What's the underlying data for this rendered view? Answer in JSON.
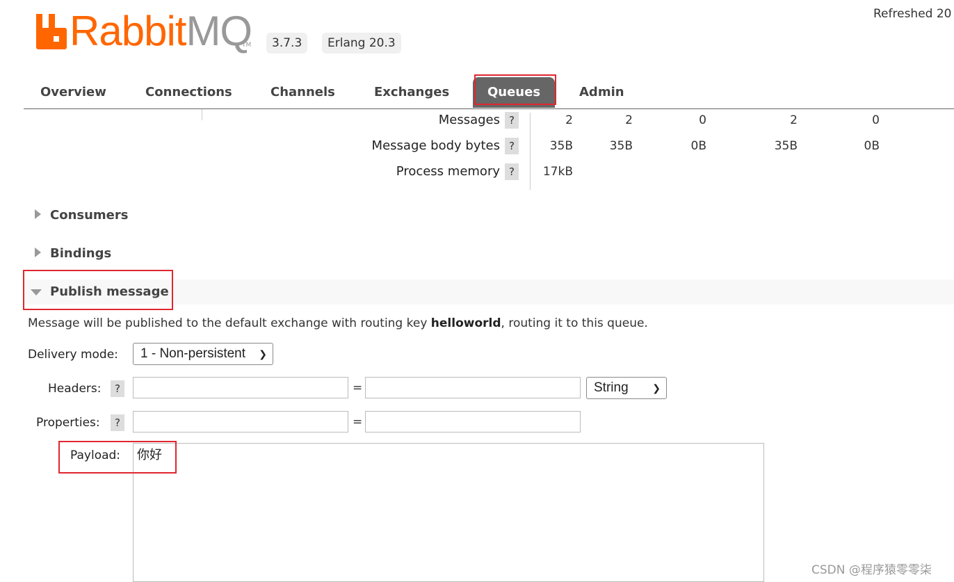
{
  "header": {
    "logo_text_a": "Rabbit",
    "logo_text_b": "MQ",
    "logo_tm": "TM",
    "version": "3.7.3",
    "erlang": "Erlang 20.3",
    "refreshed": "Refreshed 20"
  },
  "tabs": [
    "Overview",
    "Connections",
    "Channels",
    "Exchanges",
    "Queues",
    "Admin"
  ],
  "active_tab": "Queues",
  "stats": {
    "rows": [
      {
        "label": "Messages",
        "values": [
          "2",
          "2",
          "0",
          "2",
          "0"
        ]
      },
      {
        "label": "Message body bytes",
        "values": [
          "35B",
          "35B",
          "0B",
          "35B",
          "0B"
        ]
      },
      {
        "label": "Process memory",
        "values": [
          "17kB"
        ]
      }
    ],
    "help": "?"
  },
  "sections": {
    "consumers": "Consumers",
    "bindings": "Bindings",
    "publish": "Publish message"
  },
  "publish": {
    "desc_pre": "Message will be published to the default exchange with routing key ",
    "routing_key": "helloworld",
    "desc_post": ", routing it to this queue.",
    "delivery_label": "Delivery mode:",
    "delivery_value": "1 - Non-persistent",
    "headers_label": "Headers:",
    "properties_label": "Properties:",
    "eq": "=",
    "type_value": "String",
    "payload_label": "Payload:",
    "payload_value": "你好"
  },
  "watermark": "CSDN @程序猿零零柒",
  "colors": {
    "brand_orange": "#ff6600",
    "highlight_red": "#e0262f",
    "active_tab_bg": "#666666"
  }
}
